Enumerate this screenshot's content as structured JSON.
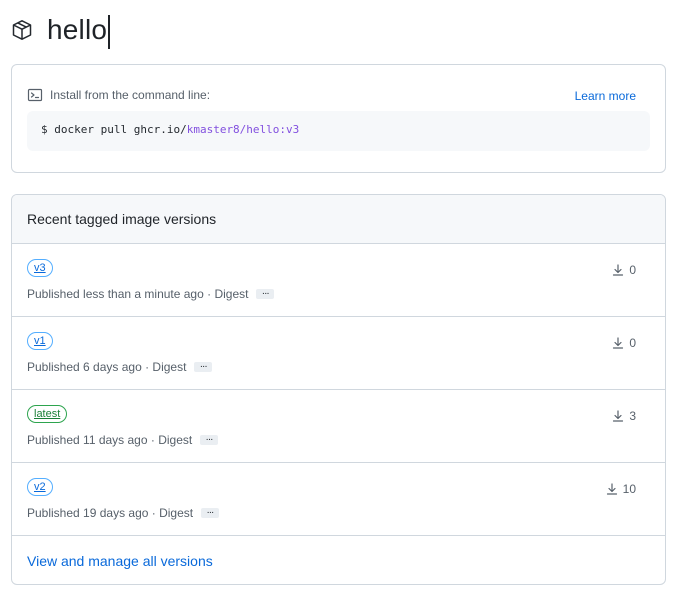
{
  "package": {
    "icon": "package-icon",
    "name": "hello"
  },
  "install": {
    "icon": "terminal-icon",
    "label": "Install from the command line:",
    "learn_more": "Learn more",
    "command": {
      "prefix": "$ docker pull ghcr.io/",
      "image": "kmaster8/hello:v3"
    }
  },
  "versions": {
    "title": "Recent tagged image versions",
    "items": [
      {
        "tag": "v3",
        "tag_style": "blue",
        "published": "Published less than a minute ago · Digest",
        "more": "...",
        "downloads": "0"
      },
      {
        "tag": "v1",
        "tag_style": "blue",
        "published": "Published 6 days ago · Digest",
        "more": "...",
        "downloads": "0"
      },
      {
        "tag": "latest",
        "tag_style": "green",
        "published": "Published 11 days ago · Digest",
        "more": "...",
        "downloads": "3"
      },
      {
        "tag": "v2",
        "tag_style": "blue",
        "published": "Published 19 days ago · Digest",
        "more": "...",
        "downloads": "10"
      }
    ],
    "manage_link": "View and manage all versions"
  },
  "colors": {
    "link": "#0969da",
    "accent_purple": "#8250df",
    "tag_blue": "#54aeff",
    "tag_green": "#2da44e",
    "border": "#d0d7de"
  }
}
